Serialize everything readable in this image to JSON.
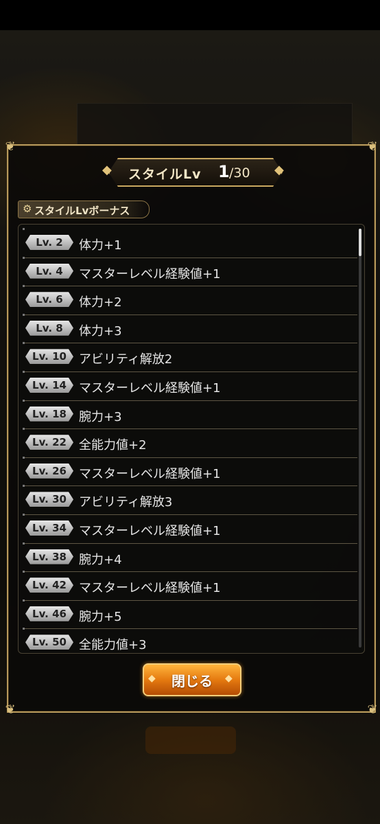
{
  "dialog": {
    "title_label": "スタイルLv",
    "current_level": "1",
    "max_level": "/30",
    "section_label": "スタイルLvボーナス",
    "close_label": "閉じる"
  },
  "bonus_rows": [
    {
      "level": "Lv.  2",
      "text": "体力+1"
    },
    {
      "level": "Lv.  4",
      "text": "マスターレベル経験値+1"
    },
    {
      "level": "Lv.  6",
      "text": "体力+2"
    },
    {
      "level": "Lv.  8",
      "text": "体力+3"
    },
    {
      "level": "Lv. 10",
      "text": "アビリティ解放2"
    },
    {
      "level": "Lv. 14",
      "text": "マスターレベル経験値+1"
    },
    {
      "level": "Lv. 18",
      "text": "腕力+3"
    },
    {
      "level": "Lv. 22",
      "text": "全能力値+2"
    },
    {
      "level": "Lv. 26",
      "text": "マスターレベル経験値+1"
    },
    {
      "level": "Lv. 30",
      "text": "アビリティ解放3"
    },
    {
      "level": "Lv. 34",
      "text": "マスターレベル経験値+1"
    },
    {
      "level": "Lv. 38",
      "text": "腕力+4"
    },
    {
      "level": "Lv. 42",
      "text": "マスターレベル経験値+1"
    },
    {
      "level": "Lv. 46",
      "text": "腕力+5"
    },
    {
      "level": "Lv. 50",
      "text": "全能力値+3"
    }
  ],
  "colors": {
    "frame_gold": "#b89a5c",
    "button_orange": "#e57a10",
    "row_text": "#e6e6e6"
  },
  "icons": {
    "section": "gear-icon",
    "corners": "ornament-icon"
  }
}
